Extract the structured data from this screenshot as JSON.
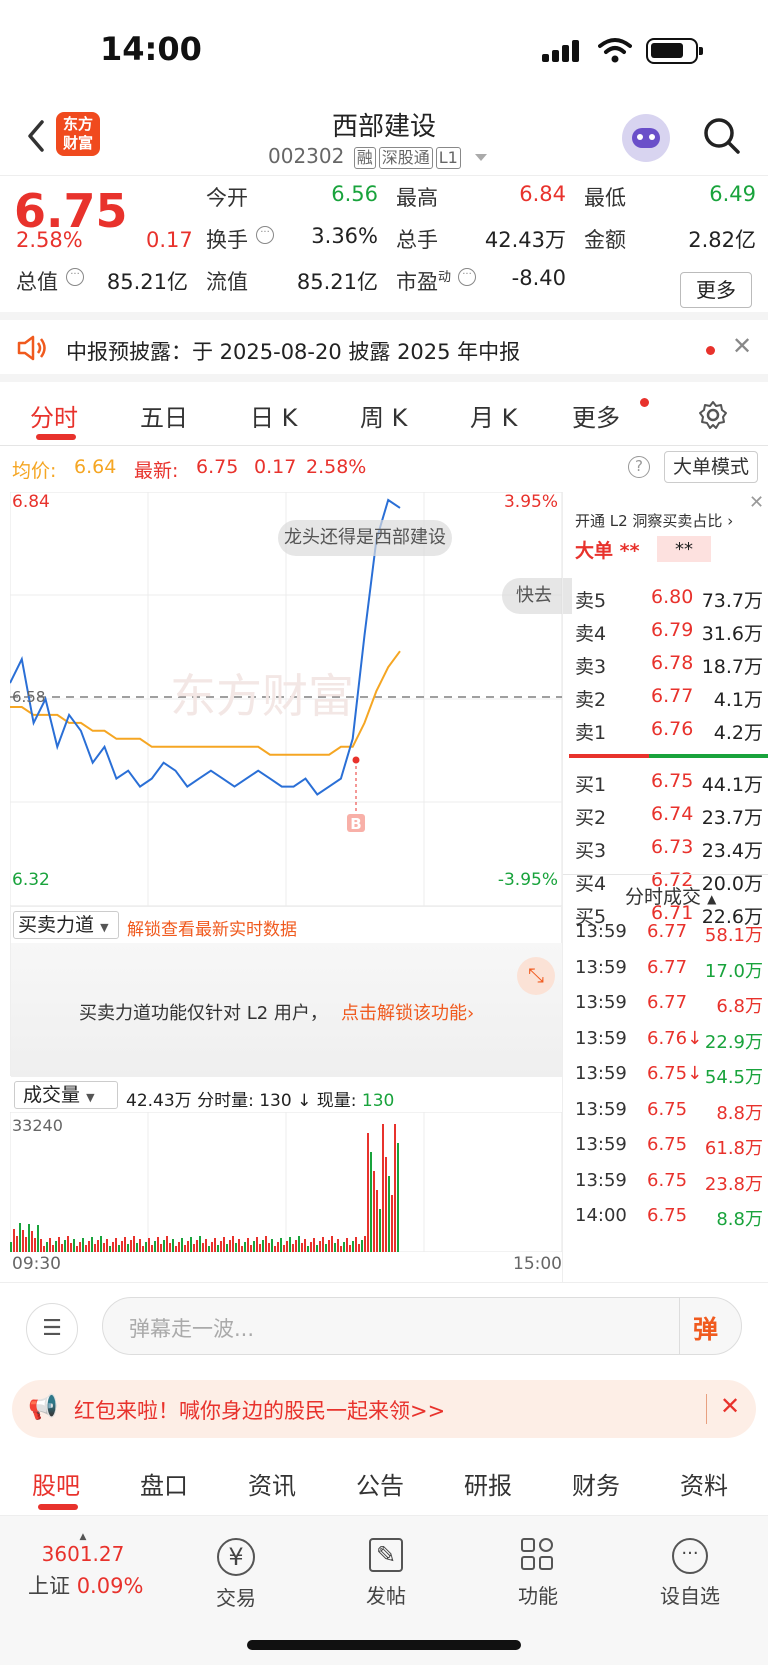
{
  "status": {
    "time": "14:00"
  },
  "header": {
    "title": "西部建设",
    "code": "002302",
    "tags": [
      "融",
      "深股通",
      "L1"
    ],
    "logo_line1": "东方",
    "logo_line2": "财富"
  },
  "quote": {
    "price": "6.75",
    "pct": "2.58%",
    "chg": "0.17",
    "open_label": "今开",
    "open": "6.56",
    "high_label": "最高",
    "high": "6.84",
    "low_label": "最低",
    "low": "6.49",
    "turnover_label": "换手",
    "turnover": "3.36%",
    "vol_label": "总手",
    "vol": "42.43万",
    "amount_label": "金额",
    "amount": "2.82亿",
    "mktcap_label": "总值",
    "mktcap": "85.21亿",
    "float_label": "流值",
    "float": "85.21亿",
    "pe_label": "市盈",
    "pe_sup": "动",
    "pe": "-8.40",
    "more": "更多"
  },
  "notice": {
    "text": "中报预披露：于 2025-08-20 披露 2025 年中报"
  },
  "tabs": [
    "分时",
    "五日",
    "日 K",
    "周 K",
    "月 K",
    "更多"
  ],
  "info": {
    "avg_label": "均价:",
    "avg": "6.64",
    "last_label": "最新:",
    "last": "6.75",
    "chg": "0.17",
    "pct": "2.58%",
    "mode_btn": "大单模式"
  },
  "chart_data": {
    "type": "line",
    "y_max": "6.84",
    "y_min": "6.32",
    "pct_max": "3.95%",
    "pct_min": "-3.95%",
    "prev_close": "6.58",
    "bullet1": "龙头还得是西部建设",
    "bullet2": "快去",
    "b_marker": "B",
    "x_start": "09:30",
    "x_end": "15:00",
    "price_series": [
      6.6,
      6.63,
      6.55,
      6.58,
      6.52,
      6.56,
      6.54,
      6.5,
      6.52,
      6.48,
      6.49,
      6.47,
      6.48,
      6.5,
      6.49,
      6.47,
      6.48,
      6.49,
      6.48,
      6.47,
      6.48,
      6.49,
      6.48,
      6.47,
      6.47,
      6.48,
      6.46,
      6.47,
      6.48,
      6.53,
      6.66,
      6.78,
      6.83,
      6.82
    ],
    "avg_series": [
      6.57,
      6.57,
      6.56,
      6.56,
      6.56,
      6.55,
      6.55,
      6.54,
      6.54,
      6.53,
      6.53,
      6.53,
      6.52,
      6.52,
      6.52,
      6.52,
      6.52,
      6.52,
      6.52,
      6.52,
      6.52,
      6.52,
      6.51,
      6.51,
      6.51,
      6.51,
      6.51,
      6.51,
      6.52,
      6.52,
      6.55,
      6.59,
      6.62,
      6.64
    ],
    "volume_max": "33240",
    "volume_total": "42.43万",
    "volume_fenshi_label": "分时量:",
    "volume_fenshi": "130",
    "volume_now_label": "现量:",
    "volume_now": "130"
  },
  "power": {
    "select": "买卖力道",
    "unlock": "解锁查看最新实时数据",
    "msg": "买卖力道功能仅针对 L2 用户，",
    "link": "点击解锁该功能"
  },
  "vol_select": "成交量",
  "orderbook": {
    "l2_tip": "开通 L2 洞察买卖占比",
    "big": "大单",
    "stars": "**",
    "asks": [
      [
        "卖5",
        "6.80",
        "73.7万"
      ],
      [
        "卖4",
        "6.79",
        "31.6万"
      ],
      [
        "卖3",
        "6.78",
        "18.7万"
      ],
      [
        "卖2",
        "6.77",
        "4.1万"
      ],
      [
        "卖1",
        "6.76",
        "4.2万"
      ]
    ],
    "bids": [
      [
        "买1",
        "6.75",
        "44.1万"
      ],
      [
        "买2",
        "6.74",
        "23.7万"
      ],
      [
        "买3",
        "6.73",
        "23.4万"
      ],
      [
        "买4",
        "6.72",
        "20.0万"
      ],
      [
        "买5",
        "6.71",
        "22.6万"
      ]
    ],
    "ticks_label": "分时成交",
    "ticks": [
      [
        "13:59",
        "6.77",
        "58.1万",
        "r"
      ],
      [
        "13:59",
        "6.77",
        "17.0万",
        "g"
      ],
      [
        "13:59",
        "6.77",
        "6.8万",
        "r"
      ],
      [
        "13:59",
        "6.76↓",
        "22.9万",
        "g"
      ],
      [
        "13:59",
        "6.75↓",
        "54.5万",
        "g"
      ],
      [
        "13:59",
        "6.75",
        "8.8万",
        "r"
      ],
      [
        "13:59",
        "6.75",
        "61.8万",
        "r"
      ],
      [
        "13:59",
        "6.75",
        "23.8万",
        "r"
      ],
      [
        "14:00",
        "6.75",
        "8.8万",
        "g"
      ]
    ]
  },
  "comment": {
    "placeholder": "弹幕走一波...",
    "btn": "弹"
  },
  "banner": {
    "text": "红包来啦！喊你身边的股民一起来领>>"
  },
  "btabs": [
    "股吧",
    "盘口",
    "资讯",
    "公告",
    "研报",
    "财务",
    "资料"
  ],
  "bottom": {
    "index_value": "3601.27",
    "index_name": "上证",
    "index_pct": "0.09%",
    "items": [
      "交易",
      "发帖",
      "功能",
      "设自选"
    ]
  },
  "colors": {
    "up": "#e8322c",
    "down": "#19a33c",
    "avg": "#f5a623",
    "price_line": "#2a6fd6"
  }
}
